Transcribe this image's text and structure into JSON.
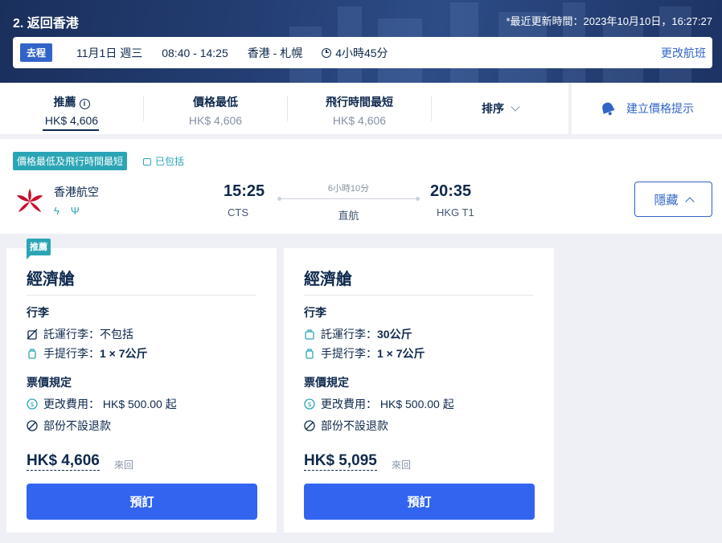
{
  "header": {
    "title": "2. 返回香港",
    "updated": "*最近更新時間：2023年10月10日，16:27:27",
    "trip": {
      "tag": "去程",
      "date": "11月1日 週三",
      "time": "08:40 - 14:25",
      "route": "香港 - 札幌",
      "duration": "4小時45分",
      "change_label": "更改航班"
    }
  },
  "sort": {
    "tabs": [
      {
        "label": "推薦",
        "value": "HK$ 4,606"
      },
      {
        "label": "價格最低",
        "value": "HK$ 4,606"
      },
      {
        "label": "飛行時間最短",
        "value": "HK$ 4,606"
      }
    ],
    "dropdown_label": "排序",
    "alert_label": "建立價格提示"
  },
  "flight": {
    "badge_best": "價格最低及飛行時間最短",
    "badge_included": "已包括",
    "airline": "香港航空",
    "dep_time": "15:25",
    "dep_airport": "CTS",
    "duration": "6小時10分",
    "stops": "直航",
    "arr_time": "20:35",
    "arr_airport": "HKG T1",
    "hide_label": "隱藏"
  },
  "fares": [
    {
      "tag": "推薦",
      "cabin": "經濟艙",
      "baggage_title": "行李",
      "checked_label": "託運行李：",
      "checked_value": "不包括",
      "carry_label": "手提行李：",
      "carry_value": "1 × 7公斤",
      "rules_title": "票價規定",
      "change_fee": "更改費用： HK$ 500.00 起",
      "refund": "部份不設退款",
      "price": "HK$ 4,606",
      "price_note": "來回",
      "book_label": "預訂"
    },
    {
      "cabin": "經濟艙",
      "baggage_title": "行李",
      "checked_label": "託運行李：",
      "checked_value": "30公斤",
      "carry_label": "手提行李：",
      "carry_value": "1 × 7公斤",
      "rules_title": "票價規定",
      "change_fee": "更改費用： HK$ 500.00 起",
      "refund": "部份不設退款",
      "price": "HK$ 5,095",
      "price_note": "來回",
      "book_label": "預訂"
    }
  ],
  "colors": {
    "accent": "#3264c8",
    "button": "#3264f0",
    "teal": "#2ba5b5",
    "text": "#0f294d",
    "airline_red": "#c8102e"
  }
}
